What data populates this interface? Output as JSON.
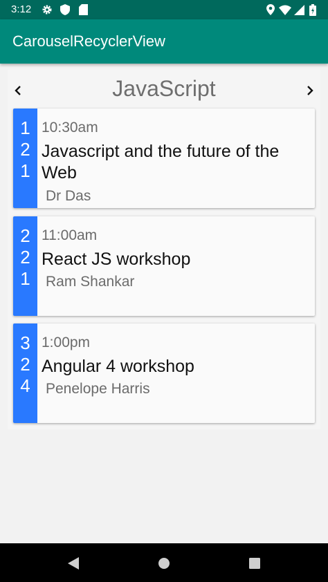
{
  "status_bar": {
    "time": "3:12",
    "icons": [
      "gear-icon",
      "shield-icon",
      "sd-card-icon",
      "location-icon",
      "wifi-icon",
      "signal-icon",
      "battery-icon"
    ]
  },
  "app_bar": {
    "title": "CarouselRecyclerView"
  },
  "carousel": {
    "category": "JavaScript",
    "prev_icon": "chevron-left-icon",
    "next_icon": "chevron-right-icon"
  },
  "sessions": [
    {
      "digits": [
        "1",
        "2",
        "1"
      ],
      "time": "10:30am",
      "title": "Javascript and the future of the Web",
      "speaker": "Dr Das"
    },
    {
      "digits": [
        "2",
        "2",
        "1"
      ],
      "time": "11:00am",
      "title": "React JS workshop",
      "speaker": "Ram Shankar"
    },
    {
      "digits": [
        "3",
        "2",
        "4"
      ],
      "time": "1:00pm",
      "title": "Angular 4 workshop",
      "speaker": "Penelope Harris"
    }
  ],
  "colors": {
    "status_bar": "#00695c",
    "app_bar": "#00897b",
    "card_accent": "#2979ff"
  },
  "nav_bar": {
    "icons": [
      "back-icon",
      "home-icon",
      "recents-icon"
    ]
  }
}
